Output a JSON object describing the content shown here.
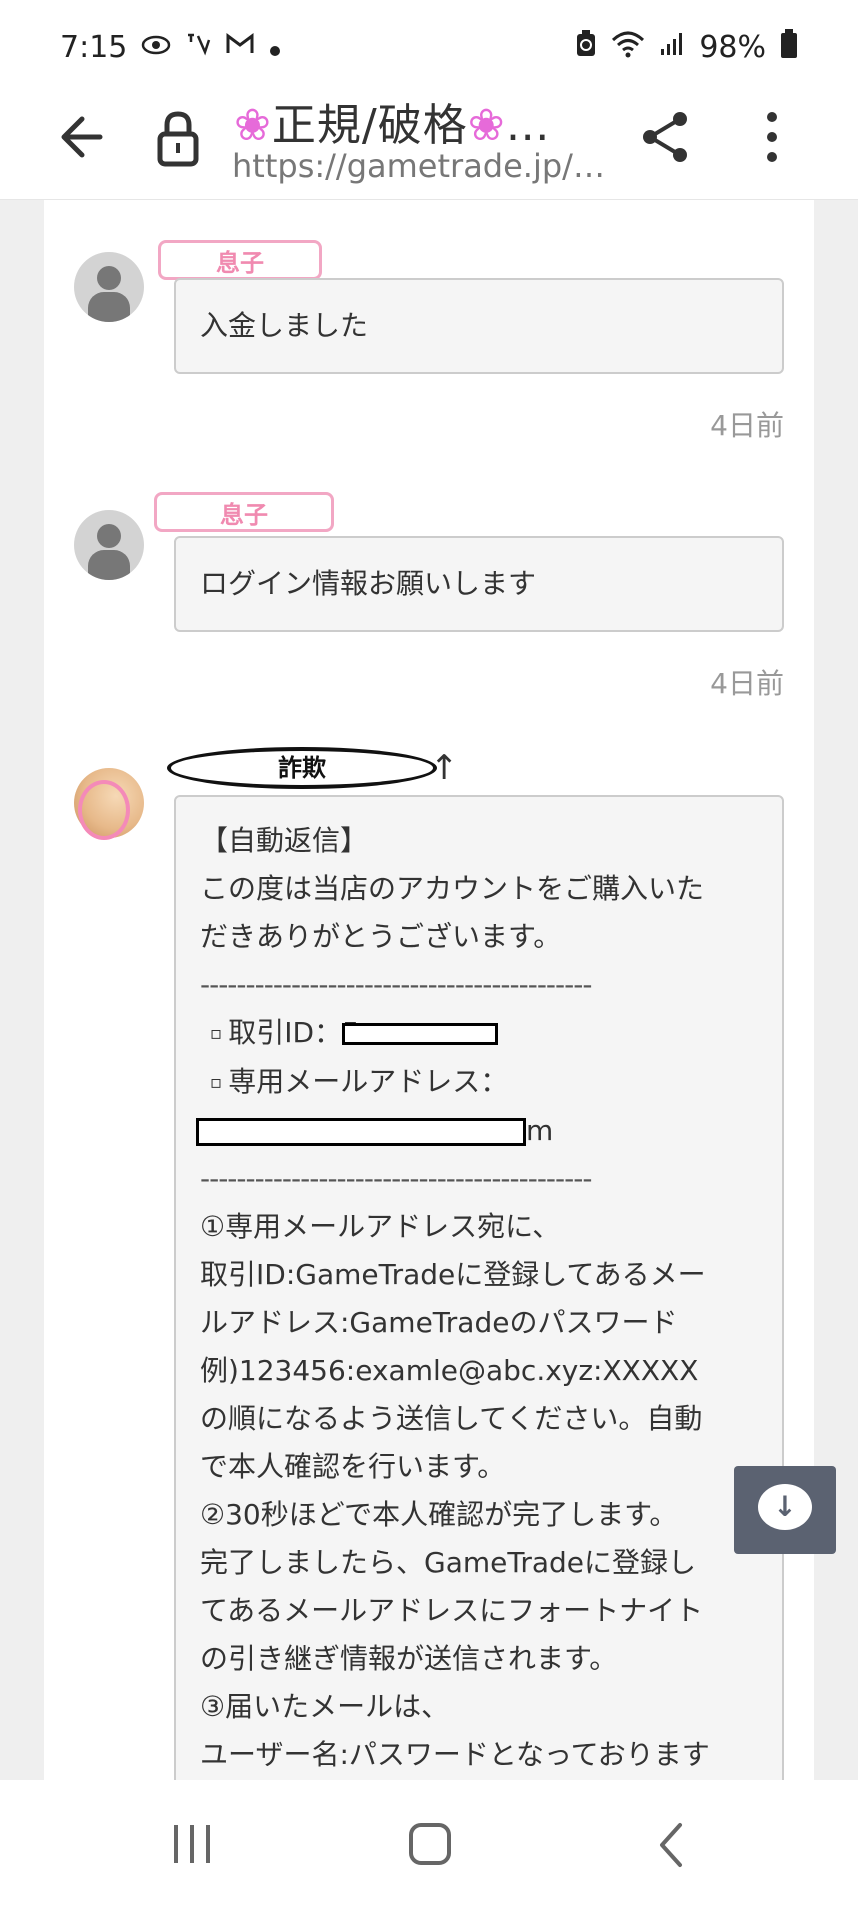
{
  "status_bar": {
    "time": "7:15",
    "battery": "98%",
    "icons_left": [
      "eye-icon",
      "voicemail-icon",
      "gmail-icon",
      "dot-icon"
    ],
    "icons_right": [
      "battery-saver-icon",
      "wifi-icon",
      "signal-icon",
      "battery-icon"
    ]
  },
  "browser": {
    "title_flower": "❀",
    "title_text": "正規/破格",
    "title_ellipsis": "…",
    "url": "https://gametrade.jp/…"
  },
  "messages": [
    {
      "sender": "息子",
      "text": "入金しました",
      "time": "4日前"
    },
    {
      "sender": "息子",
      "text": "ログイン情報お願いします",
      "time": "4日前"
    }
  ],
  "seller": {
    "label": "詐欺",
    "lines": [
      "【自動返信】",
      "この度は当店のアカウントをご購入いた",
      "だきありがとうございます。",
      "-------------------------------------------",
      "取引ID：5",
      "専用メールアドレス：",
      "m",
      "-------------------------------------------",
      "①専用メールアドレス宛に、",
      "取引ID:GameTradeに登録してあるメー",
      "ルアドレス:GameTradeのパスワード",
      "例)123456:examle@abc.xyz:XXXXX",
      "の順になるよう送信してください。自動",
      "で本人確認を行います。",
      "②30秒ほどで本人確認が完了します。",
      "完了しましたら、GameTradeに登録し",
      "てあるメールアドレスにフォートナイト",
      "の引き継ぎ情報が送信されます。",
      "③届いたメールは、",
      "ユーザー名:パスワードとなっております"
    ]
  },
  "fab": {
    "icon": "↓"
  },
  "colors": {
    "badge_pink": "#f2a7c4",
    "fab_bg": "#5b6271",
    "page_bg": "#efefef",
    "bubble_bg": "#f5f5f5"
  }
}
